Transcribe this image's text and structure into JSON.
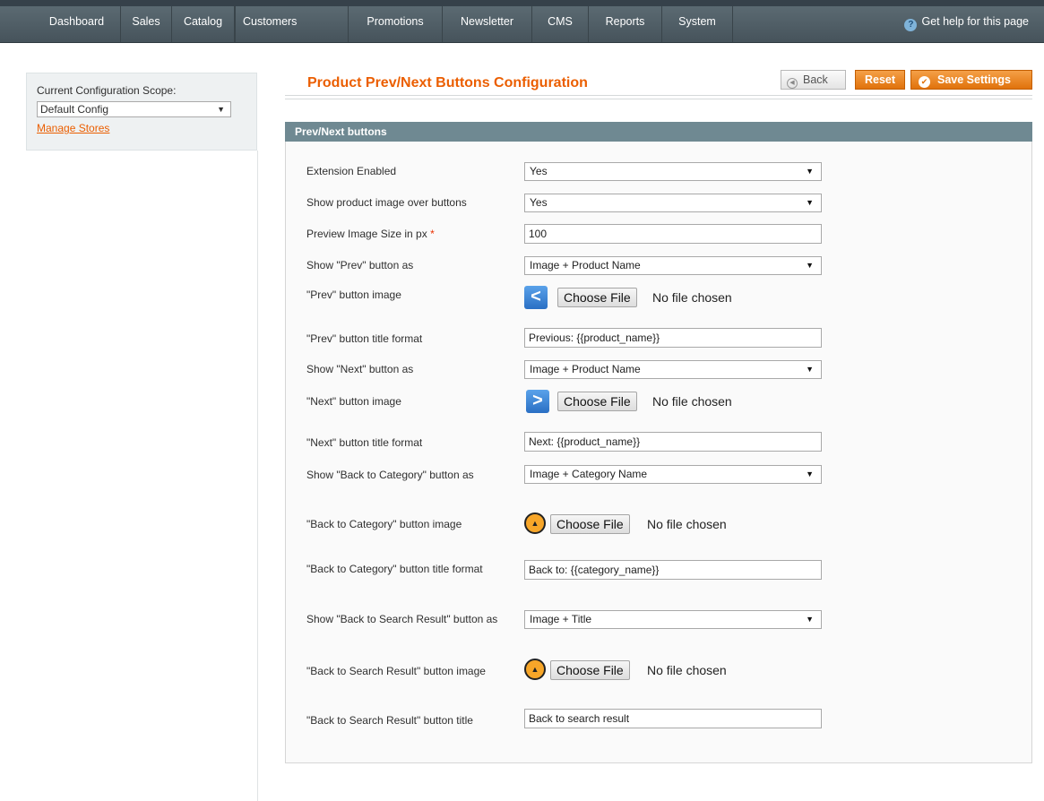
{
  "nav": {
    "items": [
      "Dashboard",
      "Sales",
      "Catalog",
      "Customers",
      "Promotions",
      "Newsletter",
      "CMS",
      "Reports",
      "System"
    ],
    "help_text": "Get help for this page",
    "help_icon": "question-circle-icon"
  },
  "sidebar": {
    "scope_label": "Current Configuration Scope:",
    "scope_value": "Default Config",
    "manage_link": "Manage Stores"
  },
  "header": {
    "title": "Product Prev/Next Buttons Configuration",
    "back_label": "Back",
    "reset_label": "Reset",
    "save_label": "Save Settings"
  },
  "section": {
    "title": "Prev/Next buttons",
    "fields": {
      "extension_enabled": {
        "label": "Extension Enabled",
        "value": "Yes"
      },
      "show_image": {
        "label": "Show product image over buttons",
        "value": "Yes"
      },
      "preview_size": {
        "label": "Preview Image Size in px",
        "required_mark": "*",
        "value": "100"
      },
      "show_prev": {
        "label": "Show \"Prev\" button as",
        "value": "Image + Product Name"
      },
      "prev_image": {
        "label": "\"Prev\" button image",
        "choose": "Choose File",
        "status": "No file chosen"
      },
      "prev_title": {
        "label": "\"Prev\" button title format",
        "value": "Previous: {{product_name}}"
      },
      "show_next": {
        "label": "Show \"Next\" button as",
        "value": "Image + Product Name"
      },
      "next_image": {
        "label": "\"Next\" button image",
        "choose": "Choose File",
        "status": "No file chosen"
      },
      "next_title": {
        "label": "\"Next\" button title format",
        "value": "Next: {{product_name}}"
      },
      "show_back_cat": {
        "label": "Show \"Back to Category\" button as",
        "value": "Image + Category Name"
      },
      "back_cat_image": {
        "label": "\"Back to Category\" button image",
        "choose": "Choose File",
        "status": "No file chosen"
      },
      "back_cat_title": {
        "label": "\"Back to Category\" button title format",
        "value": "Back to: {{category_name}}"
      },
      "show_back_search": {
        "label": "Show \"Back to Search Result\" button as",
        "value": "Image + Title"
      },
      "back_search_image": {
        "label": "\"Back to Search Result\" button image",
        "choose": "Choose File",
        "status": "No file chosen"
      },
      "back_search_title": {
        "label": "\"Back to Search Result\" button title",
        "value": "Back to search result"
      }
    }
  },
  "colors": {
    "accent": "#eb5e00",
    "nav_bg": "#4f5d65",
    "section_head": "#6f8992"
  }
}
